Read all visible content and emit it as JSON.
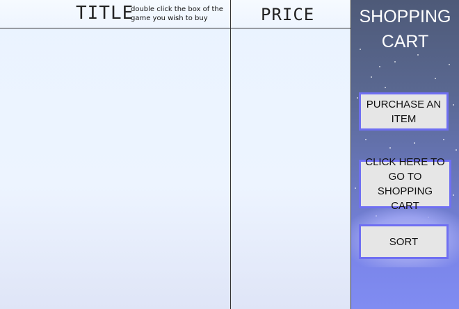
{
  "table": {
    "title_header": "TITLE",
    "hint": "double click the box of the game you wish to buy",
    "price_header": "PRICE"
  },
  "sidebar": {
    "title_line1": "SHOPPING",
    "title_line2": "CART",
    "purchase_button": "PURCHASE AN ITEM",
    "cart_button": "CLICK HERE TO GO TO SHOPPING CART",
    "sort_button": "SORT"
  },
  "colors": {
    "button_border": "#6f6ff2",
    "button_fill": "#e6e6e6",
    "sidebar_top": "#4e5a78",
    "sidebar_bottom": "#808cf2",
    "table_background": "#eaf3ff"
  }
}
